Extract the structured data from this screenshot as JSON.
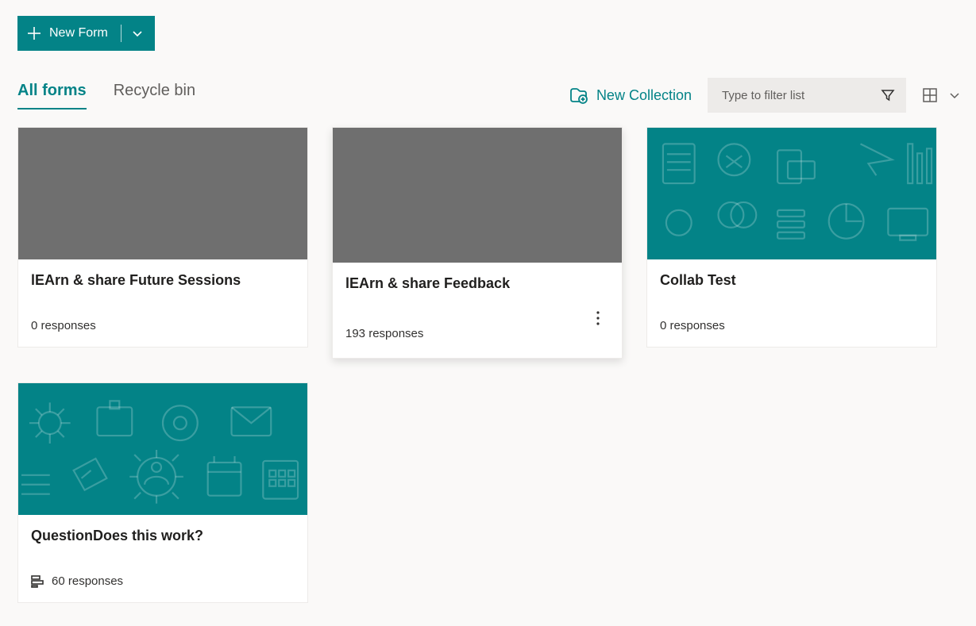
{
  "header": {
    "new_form_label": "New Form"
  },
  "tabs": {
    "all_forms": "All forms",
    "recycle_bin": "Recycle bin"
  },
  "toolbar": {
    "new_collection_label": "New Collection",
    "filter_placeholder": "Type to filter list"
  },
  "cards": [
    {
      "title": "lEArn & share Future Sessions",
      "responses": "0 responses",
      "thumb": "gray",
      "quiz_icon": false,
      "elevated": false,
      "more": false
    },
    {
      "title": "lEArn & share Feedback",
      "responses": "193 responses",
      "thumb": "gray",
      "quiz_icon": false,
      "elevated": true,
      "more": true
    },
    {
      "title": "Collab Test",
      "responses": "0 responses",
      "thumb": "teal",
      "quiz_icon": false,
      "elevated": false,
      "more": false
    },
    {
      "title": "QuestionDoes this work?",
      "responses": "60 responses",
      "thumb": "teal",
      "quiz_icon": true,
      "elevated": false,
      "more": false
    }
  ]
}
